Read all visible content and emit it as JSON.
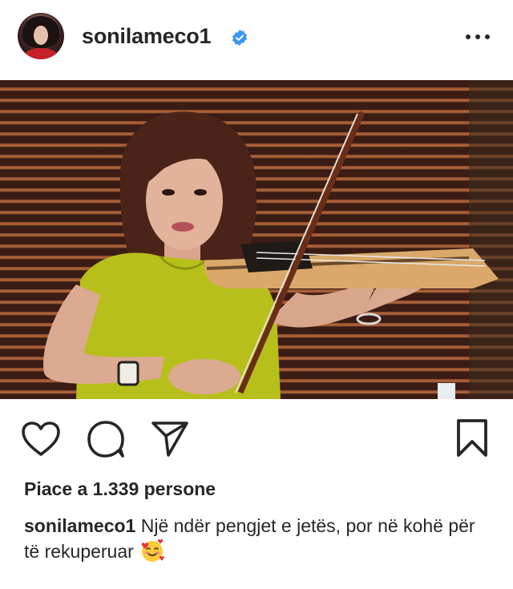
{
  "post": {
    "username": "sonilameco1",
    "verified": true,
    "likes_text": "Piace a 1.339 persone",
    "caption_user": "sonilameco1",
    "caption_text": " Një ndër pengjet e jetës, por në kohë për të rekuperuar",
    "caption_emoji": "smiling-face-with-hearts"
  },
  "colors": {
    "verified_blue": "#3897f0",
    "dress_yellow": "#b7c01a",
    "text": "#262626"
  },
  "icons": {
    "like": "heart-outline-icon",
    "comment": "speech-bubble-icon",
    "share": "paper-plane-icon",
    "save": "bookmark-icon",
    "more": "ellipsis-icon"
  }
}
